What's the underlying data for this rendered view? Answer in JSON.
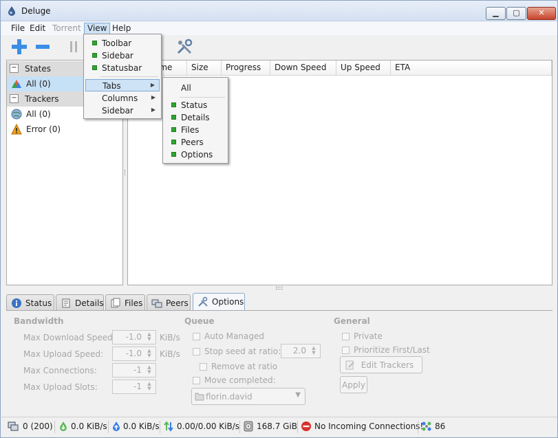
{
  "app": {
    "title": "Deluge"
  },
  "menubar": {
    "file": "File",
    "edit": "Edit",
    "torrent": "Torrent",
    "view": "View",
    "help": "Help"
  },
  "view_menu": {
    "items": [
      {
        "label": "Toolbar",
        "checked": true
      },
      {
        "label": "Sidebar",
        "checked": true
      },
      {
        "label": "Statusbar",
        "checked": true
      },
      {
        "label": "Tabs",
        "submenu": true
      },
      {
        "label": "Columns",
        "submenu": true
      },
      {
        "label": "Sidebar",
        "submenu": true
      }
    ]
  },
  "tabs_submenu": {
    "items": [
      {
        "label": "All"
      },
      {
        "label": "Status",
        "checked": true
      },
      {
        "label": "Details",
        "checked": true
      },
      {
        "label": "Files",
        "checked": true
      },
      {
        "label": "Peers",
        "checked": true
      },
      {
        "label": "Options",
        "checked": true
      }
    ]
  },
  "toolbar": {
    "icons": [
      "add-torrent-icon",
      "remove-torrent-icon",
      "pause-icon",
      "preferences-icon"
    ]
  },
  "sidebar": {
    "states": {
      "header": "States",
      "items": [
        {
          "label": "All (0)",
          "icon": "all-states-icon"
        }
      ]
    },
    "trackers": {
      "header": "Trackers",
      "items": [
        {
          "label": "All (0)",
          "icon": "globe-icon"
        },
        {
          "label": "Error (0)",
          "icon": "warning-icon"
        }
      ]
    }
  },
  "torrent_list": {
    "columns": [
      "ame",
      "Size",
      "Progress",
      "Down Speed",
      "Up Speed",
      "ETA"
    ]
  },
  "details_tabs": [
    {
      "label": "Status",
      "icon": "info-icon"
    },
    {
      "label": "Details",
      "icon": "details-icon"
    },
    {
      "label": "Files",
      "icon": "files-icon"
    },
    {
      "label": "Peers",
      "icon": "peers-icon"
    },
    {
      "label": "Options",
      "icon": "options-icon",
      "active": true
    }
  ],
  "options": {
    "bandwidth": {
      "title": "Bandwidth",
      "max_download_label": "Max Download Speed:",
      "max_download_value": "-1.0",
      "max_download_unit": "KiB/s",
      "max_upload_label": "Max Upload Speed:",
      "max_upload_value": "-1.0",
      "max_upload_unit": "KiB/s",
      "max_connections_label": "Max Connections:",
      "max_connections_value": "-1",
      "max_upload_slots_label": "Max Upload Slots:",
      "max_upload_slots_value": "-1"
    },
    "queue": {
      "title": "Queue",
      "auto_managed": "Auto Managed",
      "stop_seed_label": "Stop seed at ratio:",
      "stop_seed_value": "2.0",
      "remove_at_ratio": "Remove at ratio",
      "move_completed": "Move completed:",
      "move_path": "florin.david"
    },
    "general": {
      "title": "General",
      "private": "Private",
      "prioritize": "Prioritize First/Last",
      "edit_trackers": "Edit Trackers",
      "apply": "Apply"
    }
  },
  "statusbar": {
    "connections": "0 (200)",
    "download": "0.0 KiB/s",
    "upload": "0.0 KiB/s",
    "protocol": "0.00/0.00 KiB/s",
    "disk": "168.7 GiB",
    "incoming": "No Incoming Connections!",
    "dht": "86"
  },
  "colors": {
    "accent": "#3a8ee6",
    "check": "#2fa62f",
    "selection": "#c6e0f6"
  }
}
